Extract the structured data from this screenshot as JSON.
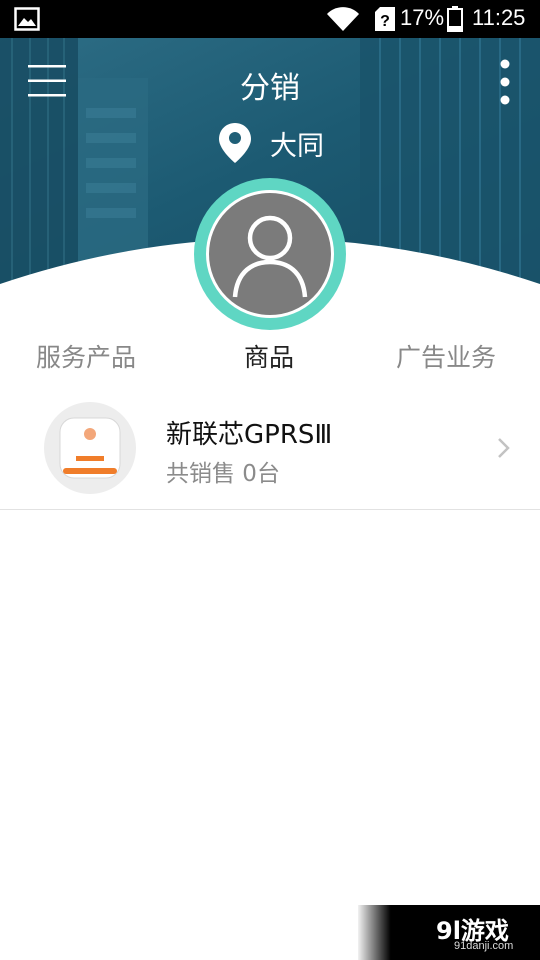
{
  "status_bar": {
    "battery": "17%",
    "time": "11:25",
    "icons": [
      "image-icon",
      "wifi-icon",
      "unknown-sim-icon",
      "battery-icon"
    ]
  },
  "header": {
    "title": "分销",
    "location": "大同",
    "icons": [
      "menu-icon",
      "more-icon",
      "location-pin-icon"
    ]
  },
  "colors": {
    "header_teal": "#1f5f77",
    "avatar_ring": "#5fd6c3",
    "avatar_bg": "#7b7b7b"
  },
  "tabs": [
    {
      "label": "服务产品",
      "active": false
    },
    {
      "label": "商品",
      "active": true
    },
    {
      "label": "广告业务",
      "active": false
    }
  ],
  "products": [
    {
      "name": "新联芯GPRSⅢ",
      "sales": "共销售 0台"
    }
  ],
  "watermark": {
    "logo": "9l游戏",
    "url": "91danji.com"
  }
}
